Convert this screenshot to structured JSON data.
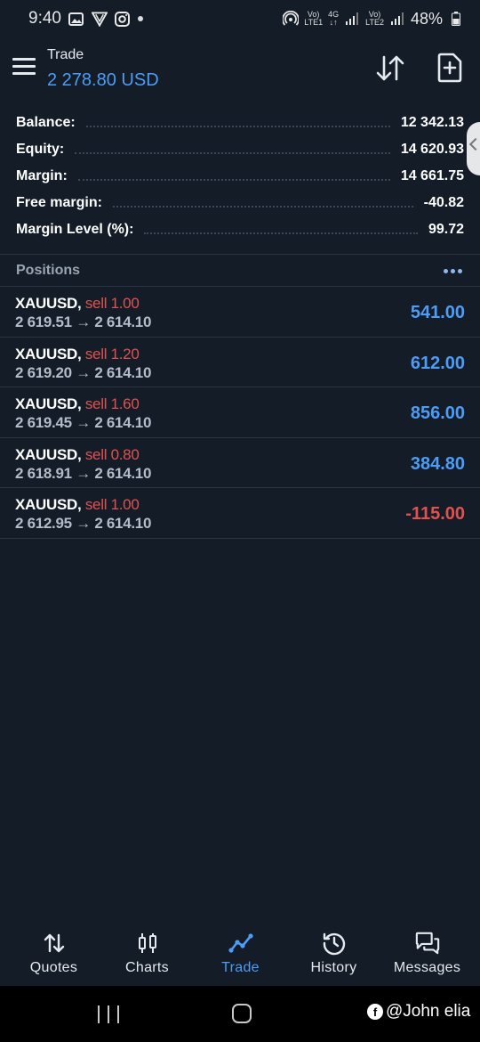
{
  "status_bar": {
    "time": "9:40",
    "sim1_label_top": "Vo)",
    "sim1_label_bottom": "LTE1",
    "network_type": "4G",
    "sim2_label_top": "Vo)",
    "sim2_label_bottom": "LTE2",
    "battery": "48%"
  },
  "header": {
    "title": "Trade",
    "subtitle": "2 278.80 USD"
  },
  "summary": [
    {
      "label": "Balance:",
      "value": "12 342.13"
    },
    {
      "label": "Equity:",
      "value": "14 620.93"
    },
    {
      "label": "Margin:",
      "value": "14 661.75"
    },
    {
      "label": "Free margin:",
      "value": "-40.82"
    },
    {
      "label": "Margin Level (%):",
      "value": "99.72"
    }
  ],
  "positions": {
    "title": "Positions",
    "items": [
      {
        "symbol": "XAUUSD,",
        "side": "sell 1.00",
        "prices": "2 619.51 → 2 614.10",
        "profit": "541.00"
      },
      {
        "symbol": "XAUUSD,",
        "side": "sell 1.20",
        "prices": "2 619.20 → 2 614.10",
        "profit": "612.00"
      },
      {
        "symbol": "XAUUSD,",
        "side": "sell 1.60",
        "prices": "2 619.45 → 2 614.10",
        "profit": "856.00"
      },
      {
        "symbol": "XAUUSD,",
        "side": "sell 0.80",
        "prices": "2 618.91 → 2 614.10",
        "profit": "384.80"
      },
      {
        "symbol": "XAUUSD,",
        "side": "sell 1.00",
        "prices": "2 612.95 → 2 614.10",
        "profit": "-115.00"
      }
    ]
  },
  "colors": {
    "background": "#131c27",
    "accent": "#4d9cf5",
    "sell": "#e0524f",
    "profit_positive": "#4d9cf5",
    "profit_negative": "#e0524f"
  },
  "bottom_nav": [
    {
      "label": "Quotes",
      "icon": "quotes-arrows-icon"
    },
    {
      "label": "Charts",
      "icon": "candlestick-chart-icon"
    },
    {
      "label": "Trade",
      "icon": "trade-line-icon",
      "active": true
    },
    {
      "label": "History",
      "icon": "history-clock-icon"
    },
    {
      "label": "Messages",
      "icon": "messages-chat-icon"
    }
  ],
  "watermark": "@John elia"
}
